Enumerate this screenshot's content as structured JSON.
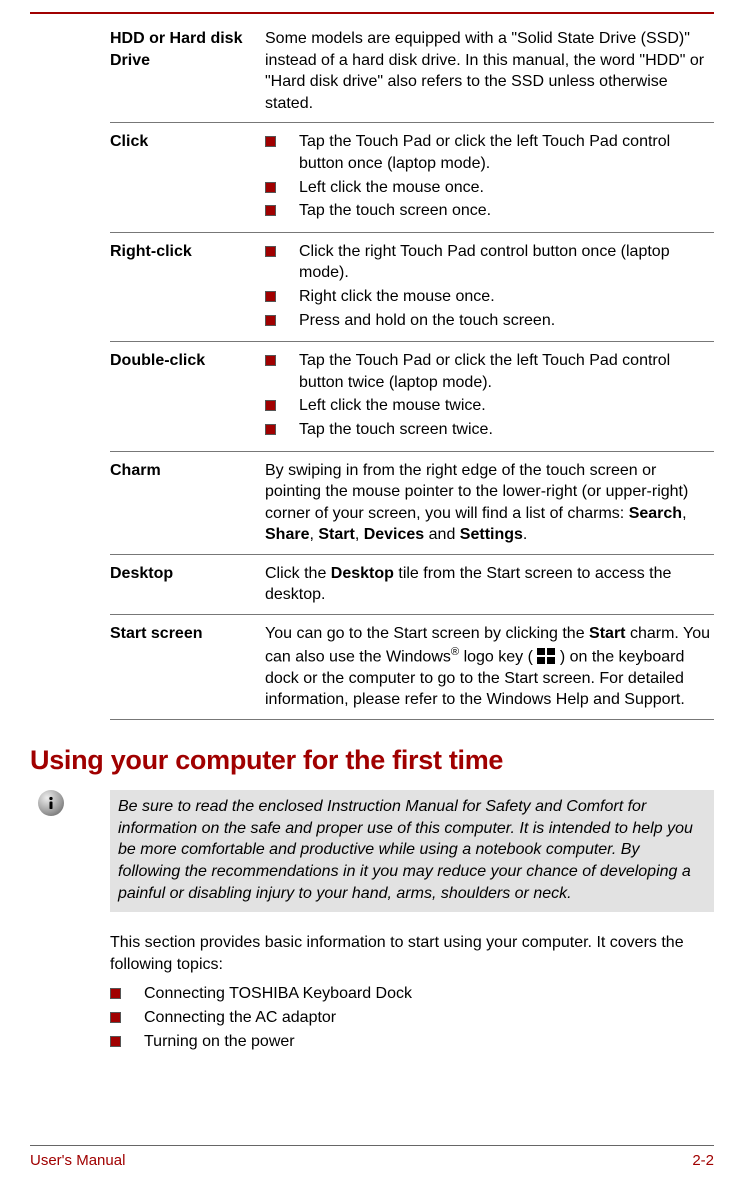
{
  "definitions": [
    {
      "term": "HDD or Hard disk Drive",
      "text": "Some models are equipped with a \"Solid State Drive (SSD)\" instead of a hard disk drive. In this manual, the word \"HDD\" or \"Hard disk drive\" also refers to the SSD unless otherwise stated."
    },
    {
      "term": "Click",
      "bullets": [
        "Tap the Touch Pad or click the left Touch Pad control button once (laptop mode).",
        "Left click the mouse once.",
        "Tap the touch screen once."
      ]
    },
    {
      "term": "Right-click",
      "bullets": [
        "Click the right Touch Pad control button once (laptop mode).",
        "Right click the mouse once.",
        "Press and hold on the touch screen."
      ]
    },
    {
      "term": "Double-click",
      "bullets": [
        "Tap the Touch Pad or click the left Touch Pad control button twice (laptop mode).",
        "Left click the mouse twice.",
        "Tap the touch screen twice."
      ]
    },
    {
      "term": "Charm",
      "charm_pre": "By swiping in from the right edge of the touch screen or pointing the mouse pointer to the lower-right (or upper-right) corner of your screen, you will find a list of charms: ",
      "charm_bold": [
        "Search",
        "Share",
        "Start",
        "Devices",
        "Settings"
      ]
    },
    {
      "term": "Desktop",
      "desktop_pre": "Click the ",
      "desktop_bold": "Desktop",
      "desktop_post": " tile from the Start screen to access the desktop."
    },
    {
      "term": "Start screen",
      "ss_pre": "You can go to the Start screen by clicking the ",
      "ss_bold": "Start",
      "ss_mid1": " charm. You can also use the Windows",
      "ss_sup": "®",
      "ss_mid2": " logo key ( ",
      "ss_mid3": " ) on the keyboard dock or the computer to go to the Start screen. For detailed information, please refer to the Windows Help and Support."
    }
  ],
  "heading": "Using your computer for the first time",
  "note": "Be sure to read the enclosed Instruction Manual for Safety and Comfort for information on the safe and proper use of this computer. It is intended to help you be more comfortable and productive while using a notebook computer. By following the recommendations in it you may reduce your chance of developing a painful or disabling injury to your hand, arms, shoulders or neck.",
  "intro": "This section provides basic information to start using your computer. It covers the following topics:",
  "topics": [
    "Connecting TOSHIBA Keyboard Dock",
    "Connecting the AC adaptor",
    "Turning on the power"
  ],
  "footer": {
    "left": "User's Manual",
    "right": "2-2"
  }
}
